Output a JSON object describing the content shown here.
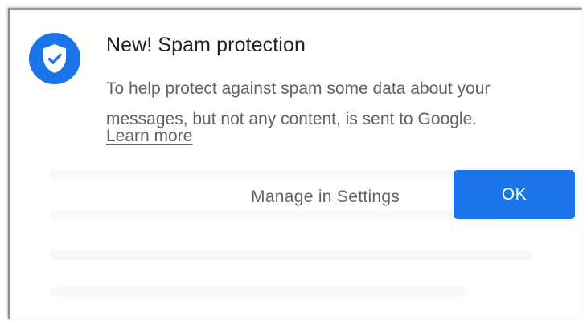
{
  "dialog": {
    "title": "New! Spam protection",
    "message": "To help protect against spam some data about your messages, but not any content, is sent to Google.",
    "learn_more_label": "Learn more",
    "icon": "shield-check-icon",
    "accent_color": "#1a73e8",
    "buttons": {
      "manage_label": "Manage in Settings",
      "ok_label": "OK"
    }
  }
}
